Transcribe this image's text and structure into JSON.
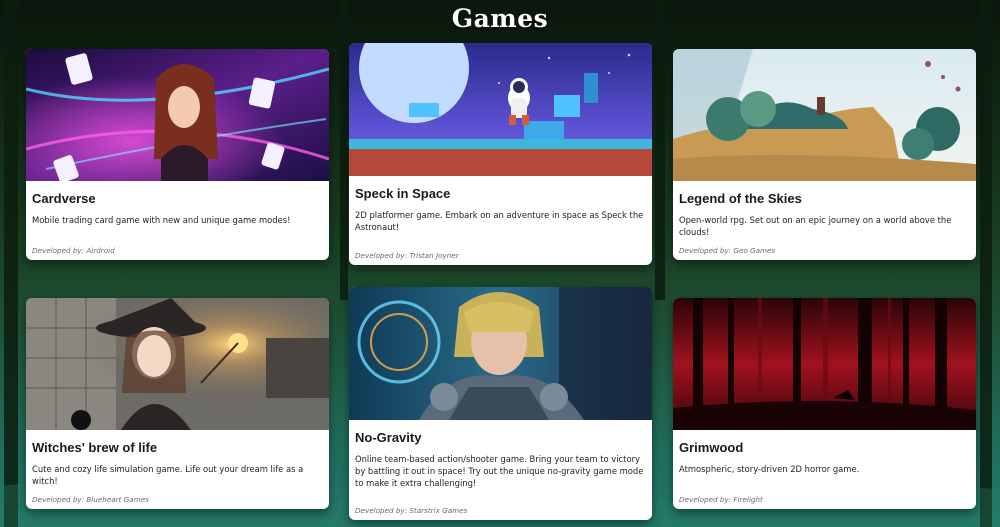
{
  "page": {
    "title": "Games"
  },
  "games": [
    {
      "name": "Cardverse",
      "description": "Mobile trading card game with new and unique game modes!",
      "developer": "Developed by: Airdroid",
      "art": "sorceress-with-playing-cards"
    },
    {
      "name": "Speck in Space",
      "description": "2D platformer game. Embark on an adventure in space as Speck the Astronaut!",
      "developer": "Developed by: Tristan Joyner",
      "art": "astronaut-on-floating-islands"
    },
    {
      "name": "Legend of the Skies",
      "description": "Open-world rpg. Set out on an epic journey on a world above the clouds!",
      "developer": "Developed by: Geo Games",
      "art": "floating-sky-island"
    },
    {
      "name": "Witches' brew of life",
      "description": "Cute and cozy life simulation game. Life out your dream life as a witch!",
      "developer": "Developed by: Blueheart Games",
      "art": "witch-with-glowing-wand"
    },
    {
      "name": "No-Gravity",
      "description": "Online team-based action/shooter game. Bring your team to victory by battling it out in space! Try out the unique no-gravity game mode to make it extra challenging!",
      "developer": "Developed by: Starstrix Games",
      "art": "armored-space-soldier"
    },
    {
      "name": "Grimwood",
      "description": "Atmospheric, story-driven 2D horror game.",
      "developer": "Developed by: Firelight",
      "art": "red-dark-forest"
    }
  ]
}
